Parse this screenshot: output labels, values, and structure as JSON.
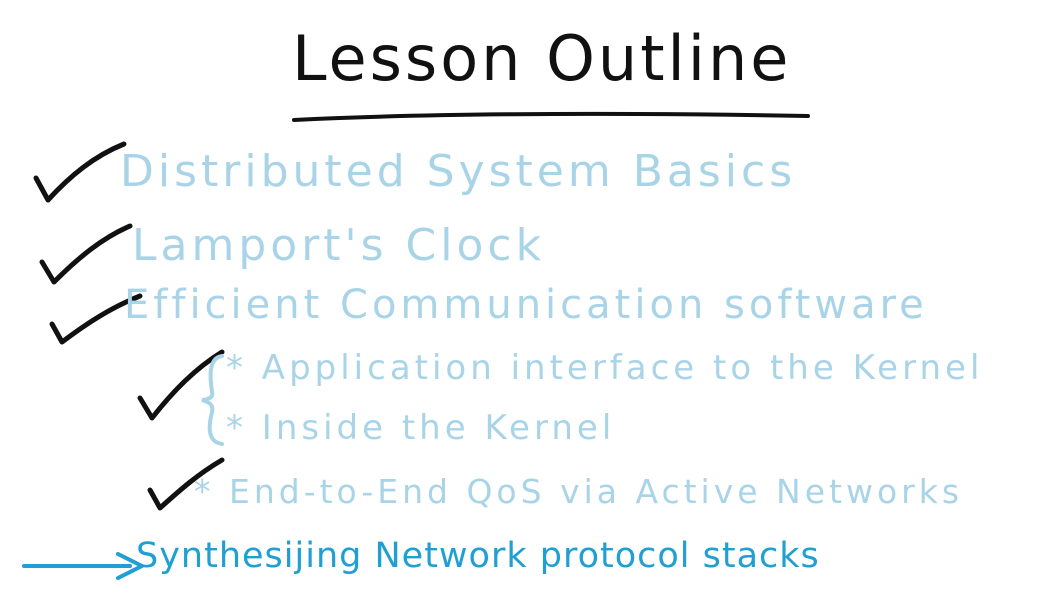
{
  "title": "Lesson Outline",
  "items": [
    {
      "text": "Distributed System Basics",
      "done": true
    },
    {
      "text": "Lamport's Clock",
      "done": true
    },
    {
      "text": "Efficient Communication software",
      "done": true
    },
    {
      "text": "* Application interface to the Kernel",
      "done": true
    },
    {
      "text": "* Inside the Kernel",
      "done": true
    },
    {
      "text": "* End-to-End QoS via Active Networks",
      "done": true
    },
    {
      "text": "Synthesijing Network protocol stacks",
      "current": true
    }
  ],
  "colors": {
    "title": "#111111",
    "completed_item": "#a9d4e8",
    "current_item": "#1f9fd2",
    "checkmark": "#111111"
  },
  "icons": [
    "checkmark-icon",
    "brace-icon",
    "arrow-right-icon"
  ]
}
